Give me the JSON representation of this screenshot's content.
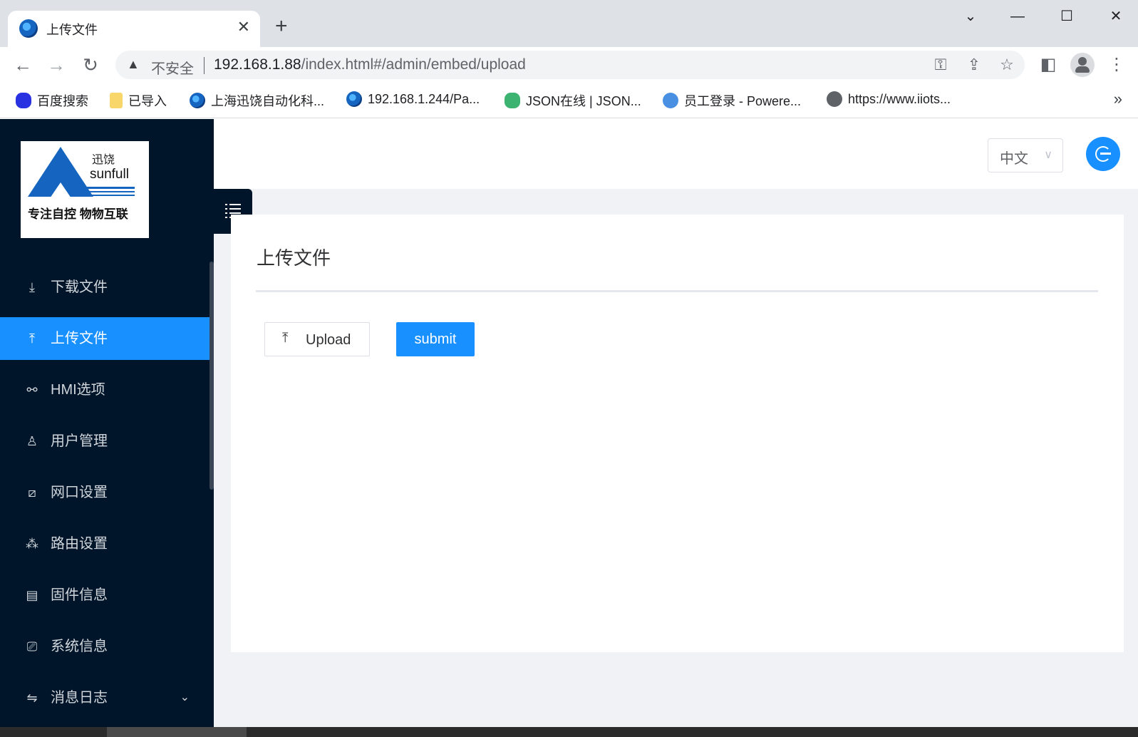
{
  "browser": {
    "tab_title": "上传文件",
    "tab_close": "✕",
    "new_tab": "+",
    "window_controls": {
      "dropdown": "⌄",
      "minimize": "—",
      "maximize": "☐",
      "close": "✕"
    },
    "security_label": "不安全",
    "url_host": "192.168.1.88",
    "url_path": "/index.html#/admin/embed/upload",
    "bookmarks": [
      {
        "label": "百度搜索",
        "icon": "baidu-icon",
        "color": "#2932e1"
      },
      {
        "label": "已导入",
        "icon": "folder-icon",
        "color": "#f9d66a"
      },
      {
        "label": "上海迅饶自动化科...",
        "icon": "site-globe-icon",
        "color": "#1565c0"
      },
      {
        "label": "192.168.1.244/Pa...",
        "icon": "site-globe-icon",
        "color": "#1565c0"
      },
      {
        "label": "JSON在线 | JSON...",
        "icon": "flower-icon",
        "color": "#3cb371"
      },
      {
        "label": "员工登录 - Powere...",
        "icon": "monkey-icon",
        "color": "#4a90e2"
      },
      {
        "label": "https://www.iiots...",
        "icon": "globe-icon",
        "color": "#5f6368"
      }
    ],
    "bookmarks_more": "»"
  },
  "sidebar": {
    "logo": {
      "brand_cn": "迅饶",
      "brand_en": "sunfull",
      "slogan": "专注自控 物物互联"
    },
    "items": [
      {
        "label": "下载文件",
        "icon": "download-icon",
        "glyph": "⤓",
        "active": false
      },
      {
        "label": "上传文件",
        "icon": "upload-icon",
        "glyph": "⤒",
        "active": true
      },
      {
        "label": "HMI选项",
        "icon": "link-icon",
        "glyph": "⚯",
        "active": false
      },
      {
        "label": "用户管理",
        "icon": "user-icon",
        "glyph": "♙",
        "active": false
      },
      {
        "label": "网口设置",
        "icon": "network-port-icon",
        "glyph": "⧄",
        "active": false
      },
      {
        "label": "路由设置",
        "icon": "route-icon",
        "glyph": "⁂",
        "active": false
      },
      {
        "label": "固件信息",
        "icon": "firmware-icon",
        "glyph": "▤",
        "active": false
      },
      {
        "label": "系统信息",
        "icon": "monitor-icon",
        "glyph": "⎚",
        "active": false
      },
      {
        "label": "消息日志",
        "icon": "swap-icon",
        "glyph": "⇋",
        "active": false,
        "expandable": true
      }
    ]
  },
  "header": {
    "language": "中文",
    "language_chevron": "∨"
  },
  "main": {
    "title": "上传文件",
    "upload_label": "Upload",
    "upload_glyph": "⤒",
    "submit_label": "submit"
  },
  "colors": {
    "sidebar_bg": "#001529",
    "accent": "#1890ff",
    "content_bg": "#f0f2f5"
  }
}
